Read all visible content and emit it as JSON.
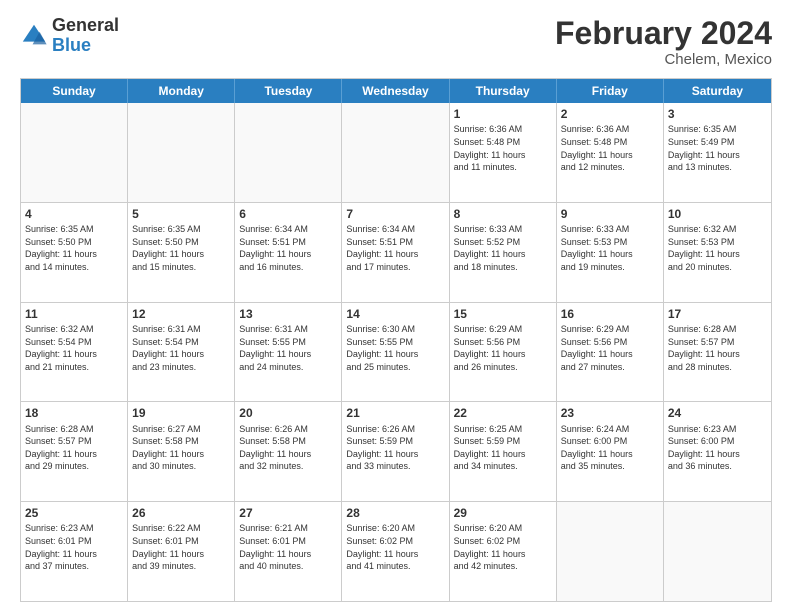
{
  "logo": {
    "general": "General",
    "blue": "Blue"
  },
  "title": "February 2024",
  "location": "Chelem, Mexico",
  "days": [
    "Sunday",
    "Monday",
    "Tuesday",
    "Wednesday",
    "Thursday",
    "Friday",
    "Saturday"
  ],
  "rows": [
    [
      {
        "day": "",
        "lines": []
      },
      {
        "day": "",
        "lines": []
      },
      {
        "day": "",
        "lines": []
      },
      {
        "day": "",
        "lines": []
      },
      {
        "day": "1",
        "lines": [
          "Sunrise: 6:36 AM",
          "Sunset: 5:48 PM",
          "Daylight: 11 hours",
          "and 11 minutes."
        ]
      },
      {
        "day": "2",
        "lines": [
          "Sunrise: 6:36 AM",
          "Sunset: 5:48 PM",
          "Daylight: 11 hours",
          "and 12 minutes."
        ]
      },
      {
        "day": "3",
        "lines": [
          "Sunrise: 6:35 AM",
          "Sunset: 5:49 PM",
          "Daylight: 11 hours",
          "and 13 minutes."
        ]
      }
    ],
    [
      {
        "day": "4",
        "lines": [
          "Sunrise: 6:35 AM",
          "Sunset: 5:50 PM",
          "Daylight: 11 hours",
          "and 14 minutes."
        ]
      },
      {
        "day": "5",
        "lines": [
          "Sunrise: 6:35 AM",
          "Sunset: 5:50 PM",
          "Daylight: 11 hours",
          "and 15 minutes."
        ]
      },
      {
        "day": "6",
        "lines": [
          "Sunrise: 6:34 AM",
          "Sunset: 5:51 PM",
          "Daylight: 11 hours",
          "and 16 minutes."
        ]
      },
      {
        "day": "7",
        "lines": [
          "Sunrise: 6:34 AM",
          "Sunset: 5:51 PM",
          "Daylight: 11 hours",
          "and 17 minutes."
        ]
      },
      {
        "day": "8",
        "lines": [
          "Sunrise: 6:33 AM",
          "Sunset: 5:52 PM",
          "Daylight: 11 hours",
          "and 18 minutes."
        ]
      },
      {
        "day": "9",
        "lines": [
          "Sunrise: 6:33 AM",
          "Sunset: 5:53 PM",
          "Daylight: 11 hours",
          "and 19 minutes."
        ]
      },
      {
        "day": "10",
        "lines": [
          "Sunrise: 6:32 AM",
          "Sunset: 5:53 PM",
          "Daylight: 11 hours",
          "and 20 minutes."
        ]
      }
    ],
    [
      {
        "day": "11",
        "lines": [
          "Sunrise: 6:32 AM",
          "Sunset: 5:54 PM",
          "Daylight: 11 hours",
          "and 21 minutes."
        ]
      },
      {
        "day": "12",
        "lines": [
          "Sunrise: 6:31 AM",
          "Sunset: 5:54 PM",
          "Daylight: 11 hours",
          "and 23 minutes."
        ]
      },
      {
        "day": "13",
        "lines": [
          "Sunrise: 6:31 AM",
          "Sunset: 5:55 PM",
          "Daylight: 11 hours",
          "and 24 minutes."
        ]
      },
      {
        "day": "14",
        "lines": [
          "Sunrise: 6:30 AM",
          "Sunset: 5:55 PM",
          "Daylight: 11 hours",
          "and 25 minutes."
        ]
      },
      {
        "day": "15",
        "lines": [
          "Sunrise: 6:29 AM",
          "Sunset: 5:56 PM",
          "Daylight: 11 hours",
          "and 26 minutes."
        ]
      },
      {
        "day": "16",
        "lines": [
          "Sunrise: 6:29 AM",
          "Sunset: 5:56 PM",
          "Daylight: 11 hours",
          "and 27 minutes."
        ]
      },
      {
        "day": "17",
        "lines": [
          "Sunrise: 6:28 AM",
          "Sunset: 5:57 PM",
          "Daylight: 11 hours",
          "and 28 minutes."
        ]
      }
    ],
    [
      {
        "day": "18",
        "lines": [
          "Sunrise: 6:28 AM",
          "Sunset: 5:57 PM",
          "Daylight: 11 hours",
          "and 29 minutes."
        ]
      },
      {
        "day": "19",
        "lines": [
          "Sunrise: 6:27 AM",
          "Sunset: 5:58 PM",
          "Daylight: 11 hours",
          "and 30 minutes."
        ]
      },
      {
        "day": "20",
        "lines": [
          "Sunrise: 6:26 AM",
          "Sunset: 5:58 PM",
          "Daylight: 11 hours",
          "and 32 minutes."
        ]
      },
      {
        "day": "21",
        "lines": [
          "Sunrise: 6:26 AM",
          "Sunset: 5:59 PM",
          "Daylight: 11 hours",
          "and 33 minutes."
        ]
      },
      {
        "day": "22",
        "lines": [
          "Sunrise: 6:25 AM",
          "Sunset: 5:59 PM",
          "Daylight: 11 hours",
          "and 34 minutes."
        ]
      },
      {
        "day": "23",
        "lines": [
          "Sunrise: 6:24 AM",
          "Sunset: 6:00 PM",
          "Daylight: 11 hours",
          "and 35 minutes."
        ]
      },
      {
        "day": "24",
        "lines": [
          "Sunrise: 6:23 AM",
          "Sunset: 6:00 PM",
          "Daylight: 11 hours",
          "and 36 minutes."
        ]
      }
    ],
    [
      {
        "day": "25",
        "lines": [
          "Sunrise: 6:23 AM",
          "Sunset: 6:01 PM",
          "Daylight: 11 hours",
          "and 37 minutes."
        ]
      },
      {
        "day": "26",
        "lines": [
          "Sunrise: 6:22 AM",
          "Sunset: 6:01 PM",
          "Daylight: 11 hours",
          "and 39 minutes."
        ]
      },
      {
        "day": "27",
        "lines": [
          "Sunrise: 6:21 AM",
          "Sunset: 6:01 PM",
          "Daylight: 11 hours",
          "and 40 minutes."
        ]
      },
      {
        "day": "28",
        "lines": [
          "Sunrise: 6:20 AM",
          "Sunset: 6:02 PM",
          "Daylight: 11 hours",
          "and 41 minutes."
        ]
      },
      {
        "day": "29",
        "lines": [
          "Sunrise: 6:20 AM",
          "Sunset: 6:02 PM",
          "Daylight: 11 hours",
          "and 42 minutes."
        ]
      },
      {
        "day": "",
        "lines": []
      },
      {
        "day": "",
        "lines": []
      }
    ]
  ]
}
